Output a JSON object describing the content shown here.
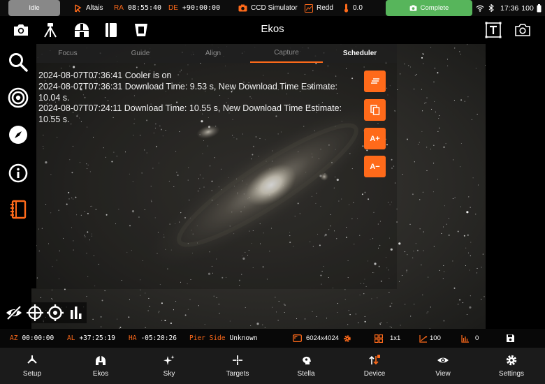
{
  "statusbar": {
    "idle": "Idle",
    "mount_name": "Altais",
    "ra_label": "RA",
    "ra_value": "08:55:40",
    "de_label": "DE",
    "de_value": "+90:00:00",
    "camera_name": "CCD Simulator",
    "filter_name": "Redd",
    "temperature": "0.0",
    "capture_status": "Complete",
    "time": "17:36",
    "battery": "100"
  },
  "toolbar": {
    "title": "Ekos"
  },
  "tabs": [
    {
      "label": "Focus"
    },
    {
      "label": "Guide"
    },
    {
      "label": "Align"
    },
    {
      "label": "Capture"
    },
    {
      "label": "Scheduler"
    }
  ],
  "log": [
    "2024-08-07T07:36:41 Cooler is on",
    "2024-08-07T07:36:31 Download Time: 9.53 s, New Download Time Estimate: 10.04 s.",
    "2024-08-07T07:24:11 Download Time: 10.55 s, New Download Time Estimate: 10.55 s."
  ],
  "fabs": {
    "font_up": "A+",
    "font_down": "A−"
  },
  "infobar": {
    "az_label": "AZ",
    "az_value": "00:00:00",
    "al_label": "AL",
    "al_value": "+37:25:19",
    "ha_label": "HA",
    "ha_value": "-05:20:26",
    "pier_label": "Pier Side",
    "pier_value": "Unknown",
    "resolution": "6024x4024",
    "binning": "1x1",
    "gain": "100",
    "offset": "0"
  },
  "bottomnav": [
    {
      "label": "Setup",
      "icon": "setup-icon"
    },
    {
      "label": "Ekos",
      "icon": "ekos-icon"
    },
    {
      "label": "Sky",
      "icon": "sky-icon"
    },
    {
      "label": "Targets",
      "icon": "targets-icon"
    },
    {
      "label": "Stella",
      "icon": "stella-icon"
    },
    {
      "label": "Device",
      "icon": "device-icon"
    },
    {
      "label": "View",
      "icon": "view-icon"
    },
    {
      "label": "Settings",
      "icon": "settings-icon"
    }
  ],
  "colors": {
    "accent": "#ff6a1a",
    "complete": "#57b55b",
    "idle": "#888888"
  }
}
